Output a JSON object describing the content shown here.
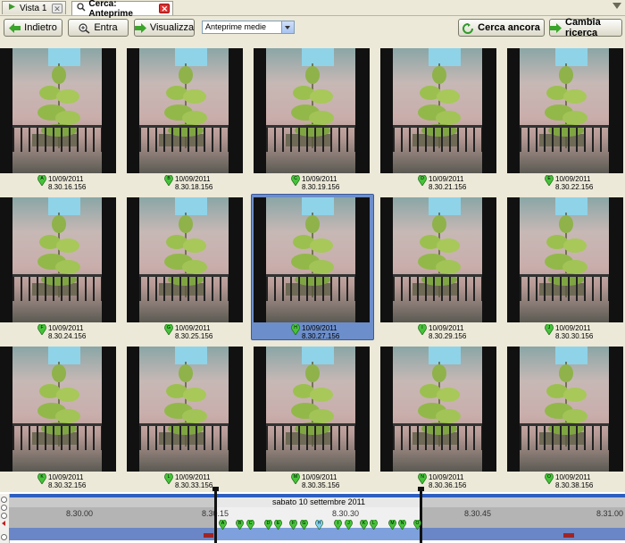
{
  "tabs": [
    {
      "label": "Vista 1",
      "icon": "play-icon",
      "active": false
    },
    {
      "label": "Cerca: Anteprime",
      "icon": "search-icon",
      "active": true
    }
  ],
  "toolbar": {
    "back_label": "Indietro",
    "enter_label": "Entra",
    "view_label": "Visualizza",
    "preview_select": "Anteprime medie",
    "search_again_label": "Cerca ancora",
    "change_search_label": "Cambia ricerca"
  },
  "thumbnails": [
    {
      "marker": "A",
      "date": "10/09/2011",
      "time": "8.30.16.156"
    },
    {
      "marker": "B",
      "date": "10/09/2011",
      "time": "8.30.18.156"
    },
    {
      "marker": "C",
      "date": "10/09/2011",
      "time": "8.30.19.156"
    },
    {
      "marker": "D",
      "date": "10/09/2011",
      "time": "8.30.21.156"
    },
    {
      "marker": "E",
      "date": "10/09/2011",
      "time": "8.30.22.156"
    },
    {
      "marker": "F",
      "date": "10/09/2011",
      "time": "8.30.24.156"
    },
    {
      "marker": "G",
      "date": "10/09/2011",
      "time": "8.30.25.156"
    },
    {
      "marker": "H",
      "date": "10/09/2011",
      "time": "8.30.27.156",
      "selected": true
    },
    {
      "marker": "I",
      "date": "10/09/2011",
      "time": "8.30.29.156"
    },
    {
      "marker": "J",
      "date": "10/09/2011",
      "time": "8.30.30.156"
    },
    {
      "marker": "K",
      "date": "10/09/2011",
      "time": "8.30.32.156"
    },
    {
      "marker": "L",
      "date": "10/09/2011",
      "time": "8.30.33.156"
    },
    {
      "marker": "M",
      "date": "10/09/2011",
      "time": "8.30.35.156"
    },
    {
      "marker": "N",
      "date": "10/09/2011",
      "time": "8.30.36.156"
    },
    {
      "marker": "O",
      "date": "10/09/2011",
      "time": "8.30.38.156"
    }
  ],
  "timeline": {
    "date_label": "sabato 10 settembre 2011",
    "ticks": [
      "8.30.00",
      "8.30.15",
      "8.30.30",
      "8.30.45",
      "8.31.00"
    ],
    "markers": [
      "A",
      "B",
      "C",
      "D",
      "E",
      "F",
      "G",
      "H",
      "I",
      "J",
      "K",
      "L",
      "M",
      "N",
      "O"
    ]
  }
}
